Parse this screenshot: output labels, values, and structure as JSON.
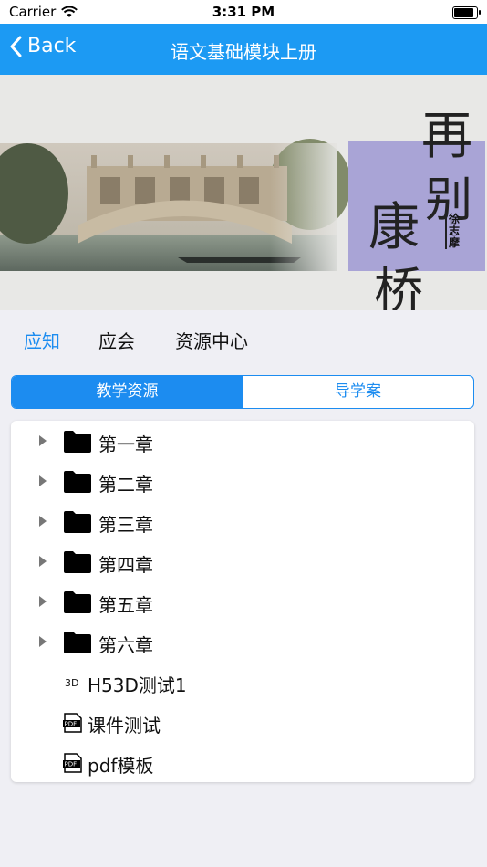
{
  "status_bar": {
    "carrier": "Carrier",
    "time": "3:31 PM"
  },
  "nav": {
    "back_label": "Back",
    "title": "语文基础模块上册"
  },
  "banner": {
    "calligraphy": [
      "再",
      "别",
      "康",
      "桥"
    ],
    "author": "徐志摩"
  },
  "tabs": [
    {
      "label": "应知",
      "active": true
    },
    {
      "label": "应会",
      "active": false
    },
    {
      "label": "资源中心",
      "active": false
    }
  ],
  "segments": [
    {
      "label": "教学资源",
      "selected": true
    },
    {
      "label": "导学案",
      "selected": false
    }
  ],
  "tree": [
    {
      "type": "folder",
      "label": "第一章"
    },
    {
      "type": "folder",
      "label": "第二章"
    },
    {
      "type": "folder",
      "label": "第三章"
    },
    {
      "type": "folder",
      "label": "第四章"
    },
    {
      "type": "folder",
      "label": "第五章"
    },
    {
      "type": "folder",
      "label": "第六章"
    },
    {
      "type": "3d",
      "label": "H53D测试1",
      "badge": "3D"
    },
    {
      "type": "pdf",
      "label": "课件测试",
      "badge": "PDF"
    },
    {
      "type": "pdf",
      "label": "pdf模板",
      "badge": "PDF"
    }
  ],
  "colors": {
    "nav_bg": "#1c9af3",
    "accent": "#1c8cf0",
    "background": "#efeff4"
  }
}
